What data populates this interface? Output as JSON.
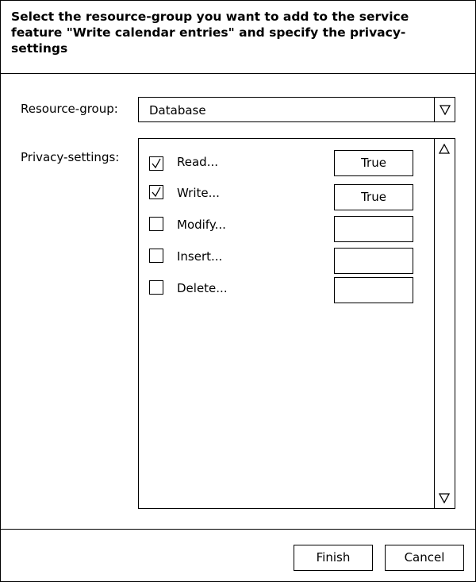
{
  "dialog": {
    "title": "Select the resource-group you want to add to the service feature \"Write calendar entries\" and specify the privacy-settings"
  },
  "form": {
    "resource_group_label": "Resource-group:",
    "resource_group_value": "Database",
    "privacy_label": "Privacy-settings:"
  },
  "privacy_items": [
    {
      "label": "Read...",
      "checked": true,
      "value": "True"
    },
    {
      "label": "Write...",
      "checked": true,
      "value": "True"
    },
    {
      "label": "Modify...",
      "checked": false,
      "value": ""
    },
    {
      "label": "Insert...",
      "checked": false,
      "value": ""
    },
    {
      "label": "Delete...",
      "checked": false,
      "value": ""
    }
  ],
  "buttons": {
    "finish": "Finish",
    "cancel": "Cancel"
  },
  "icons": {
    "dropdown": "triangle-down-icon",
    "scroll_up": "triangle-up-icon",
    "scroll_down": "triangle-down-icon",
    "check": "checkmark-icon"
  }
}
